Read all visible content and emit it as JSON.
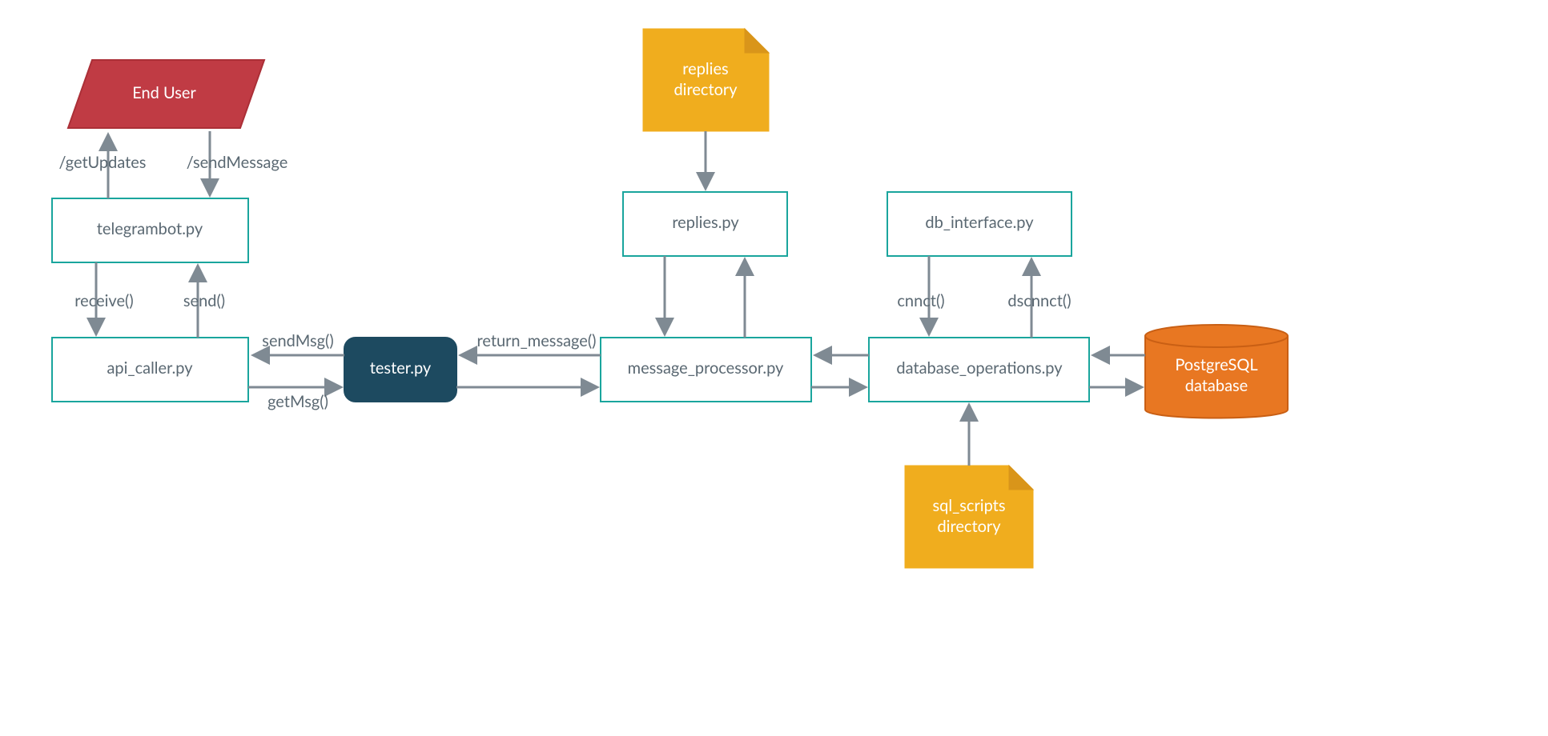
{
  "nodes": {
    "end_user": {
      "label": "End User"
    },
    "telegrambot": {
      "label": "telegrambot.py"
    },
    "api_caller": {
      "label": "api_caller.py"
    },
    "tester": {
      "label": "tester.py"
    },
    "replies_dir": {
      "line1": "replies",
      "line2": "directory"
    },
    "replies": {
      "label": "replies.py"
    },
    "msg_proc": {
      "label": "message_processor.py"
    },
    "db_iface": {
      "label": "db_interface.py"
    },
    "db_ops": {
      "label": "database_operations.py"
    },
    "sql_dir": {
      "line1": "sql_scripts",
      "line2": "directory"
    },
    "pg": {
      "line1": "PostgreSQL",
      "line2": "database"
    }
  },
  "edges": {
    "get_updates": "/getUpdates",
    "send_message_api": "/sendMessage",
    "receive": "receive()",
    "send": "send()",
    "sendMsg": "sendMsg()",
    "getMsg": "getMsg()",
    "return_msg": "return_message()",
    "cnnct": "cnnct()",
    "dscnnct": "dscnnct()"
  },
  "colors": {
    "box_border": "#1aa59d",
    "text": "#5a6872",
    "arrow": "#7f8a93",
    "note": "#f0ad1e",
    "tester": "#1d4a60",
    "enduser": "#c03b44",
    "db": "#e87722"
  }
}
